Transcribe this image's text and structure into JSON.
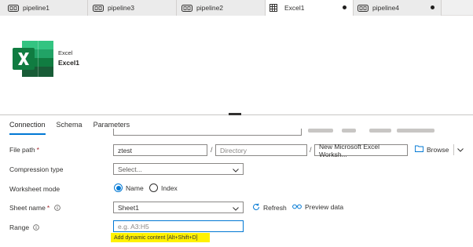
{
  "tabs": [
    {
      "label": "pipeline1",
      "icon": "pipeline-icon"
    },
    {
      "label": "pipeline3",
      "icon": "pipeline-icon"
    },
    {
      "label": "pipeline2",
      "icon": "pipeline-icon"
    },
    {
      "label": "Excel1",
      "icon": "table-icon",
      "active": true,
      "unsaved": true
    },
    {
      "label": "pipeline4",
      "icon": "pipeline-icon",
      "unsaved": true
    }
  ],
  "activity": {
    "type": "Excel",
    "name": "Excel1",
    "icon": "excel-logo-icon"
  },
  "subtabs": [
    {
      "label": "Connection",
      "active": true
    },
    {
      "label": "Schema"
    },
    {
      "label": "Parameters"
    }
  ],
  "form": {
    "file_path": {
      "label": "File path",
      "required_mark": "*",
      "container": "ztest",
      "directory_placeholder": "Directory",
      "file_name": "New Microsoft Excel Worksh...",
      "browse_label": "Browse"
    },
    "compression_type": {
      "label": "Compression type",
      "placeholder": "Select..."
    },
    "worksheet_mode": {
      "label": "Worksheet mode",
      "options": [
        "Name",
        "Index"
      ],
      "selected": "Name"
    },
    "sheet_name": {
      "label": "Sheet name",
      "required_mark": "*",
      "value": "Sheet1",
      "refresh_label": "Refresh",
      "preview_label": "Preview data"
    },
    "range": {
      "label": "Range",
      "placeholder": "e.g. A3:H5",
      "dynamic_hint": "Add dynamic content [Alt+Shift+D]"
    }
  },
  "colors": {
    "accent": "#0078d4",
    "required": "#a4262c",
    "highlight": "#fff200",
    "excel_green": "#107c41"
  }
}
